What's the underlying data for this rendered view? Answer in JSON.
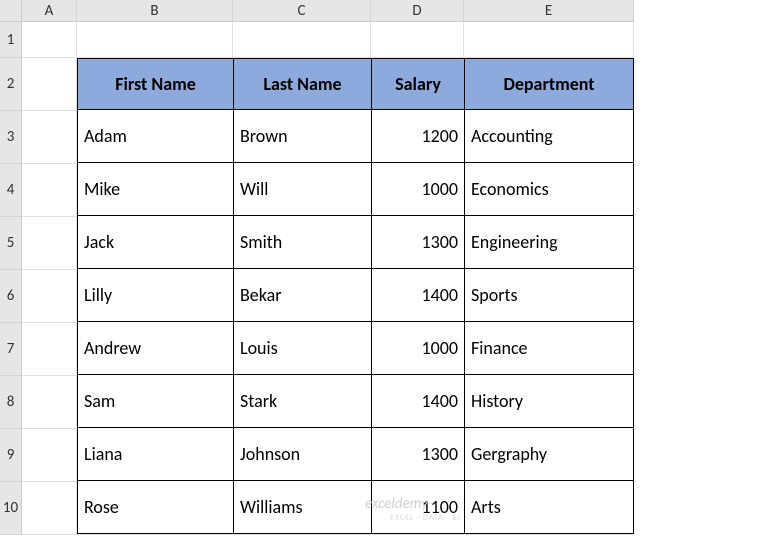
{
  "columns": [
    "A",
    "B",
    "C",
    "D",
    "E"
  ],
  "rows": [
    "1",
    "2",
    "3",
    "4",
    "5",
    "6",
    "7",
    "8",
    "9",
    "10"
  ],
  "headers": {
    "first_name": "First Name",
    "last_name": "Last Name",
    "salary": "Salary",
    "department": "Department"
  },
  "data": [
    {
      "first_name": "Adam",
      "last_name": "Brown",
      "salary": "1200",
      "department": "Accounting"
    },
    {
      "first_name": "Mike",
      "last_name": "Will",
      "salary": "1000",
      "department": "Economics"
    },
    {
      "first_name": "Jack",
      "last_name": "Smith",
      "salary": "1300",
      "department": "Engineering"
    },
    {
      "first_name": "Lilly",
      "last_name": "Bekar",
      "salary": "1400",
      "department": "Sports"
    },
    {
      "first_name": "Andrew",
      "last_name": "Louis",
      "salary": "1000",
      "department": "Finance"
    },
    {
      "first_name": "Sam",
      "last_name": "Stark",
      "salary": "1400",
      "department": "History"
    },
    {
      "first_name": "Liana",
      "last_name": "Johnson",
      "salary": "1300",
      "department": "Gergraphy"
    },
    {
      "first_name": "Rose",
      "last_name": "Williams",
      "salary": "1100",
      "department": "Arts"
    }
  ],
  "watermark": "exceldemy",
  "watermark_sub": "EXCEL · DATA · BI",
  "chart_data": {
    "type": "table",
    "title": "",
    "columns": [
      "First Name",
      "Last Name",
      "Salary",
      "Department"
    ],
    "rows": [
      [
        "Adam",
        "Brown",
        1200,
        "Accounting"
      ],
      [
        "Mike",
        "Will",
        1000,
        "Economics"
      ],
      [
        "Jack",
        "Smith",
        1300,
        "Engineering"
      ],
      [
        "Lilly",
        "Bekar",
        1400,
        "Sports"
      ],
      [
        "Andrew",
        "Louis",
        1000,
        "Finance"
      ],
      [
        "Sam",
        "Stark",
        1400,
        "History"
      ],
      [
        "Liana",
        "Johnson",
        1300,
        "Gergraphy"
      ],
      [
        "Rose",
        "Williams",
        1100,
        "Arts"
      ]
    ]
  }
}
